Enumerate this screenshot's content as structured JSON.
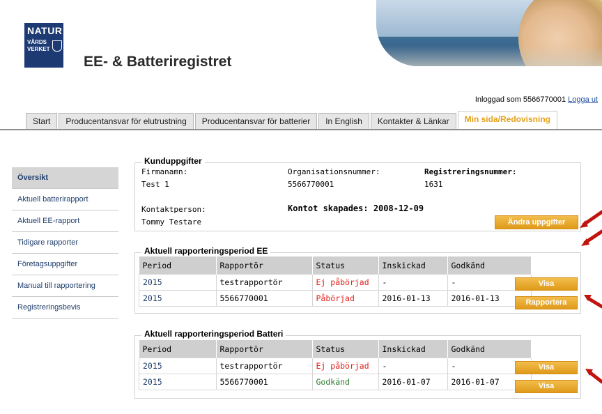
{
  "logo": {
    "line1": "NATUR",
    "line2": "VÅRDS",
    "line3": "VERKET"
  },
  "app_title": "EE- & Batteriregistret",
  "login": {
    "text": "Inloggad som 5566770001",
    "logout": "Logga ut"
  },
  "tabs": [
    {
      "label": "Start"
    },
    {
      "label": "Producentansvar för elutrustning"
    },
    {
      "label": "Producentansvar för batterier"
    },
    {
      "label": "In English"
    },
    {
      "label": "Kontakter & Länkar"
    },
    {
      "label": "Min sida/Redovisning"
    }
  ],
  "sidebar": [
    {
      "label": "Översikt"
    },
    {
      "label": "Aktuell batterirapport"
    },
    {
      "label": "Aktuell EE-rapport"
    },
    {
      "label": "Tidigare rapporter"
    },
    {
      "label": "Företagsuppgifter"
    },
    {
      "label": "Manual till rapportering"
    },
    {
      "label": "Registreringsbevis"
    }
  ],
  "customer": {
    "legend": "Kunduppgifter",
    "company_label": "Firmanamn:",
    "company_value": "Test 1",
    "org_label": "Organisationsnummer:",
    "org_value": "5566770001",
    "reg_label": "Registreringsnummer:",
    "reg_value": "1631",
    "contact_label": "Kontaktperson:",
    "contact_value": "Tommy Testare",
    "created": "Kontot skapades: 2008-12-09",
    "edit_button": "Ändra uppgifter"
  },
  "ee": {
    "legend": "Aktuell rapporteringsperiod EE",
    "headers": [
      "Period",
      "Rapportör",
      "Status",
      "Inskickad",
      "Godkänd"
    ],
    "rows": [
      {
        "period": "2015",
        "reporter": "testrapportör",
        "status": "Ej påbörjad",
        "sent": "-",
        "approved": "-",
        "action": "Visa"
      },
      {
        "period": "2015",
        "reporter": "5566770001",
        "status": "Påbörjad",
        "sent": "2016-01-13",
        "approved": "2016-01-13",
        "action": "Rapportera"
      }
    ]
  },
  "battery": {
    "legend": "Aktuell rapporteringsperiod Batteri",
    "headers": [
      "Period",
      "Rapportör",
      "Status",
      "Inskickad",
      "Godkänd"
    ],
    "rows": [
      {
        "period": "2015",
        "reporter": "testrapportör",
        "status": "Ej påbörjad",
        "sent": "-",
        "approved": "-",
        "action": "Visa"
      },
      {
        "period": "2015",
        "reporter": "5566770001",
        "status": "Godkänd",
        "sent": "2016-01-07",
        "approved": "2016-01-07",
        "action": "Visa"
      }
    ]
  },
  "colors": {
    "accent": "#e4a11a",
    "button": "#e6a429",
    "link": "#1f3d6b",
    "status_red": "#e2211b",
    "status_green": "#2c7a2c",
    "arrow": "#c0150f"
  }
}
